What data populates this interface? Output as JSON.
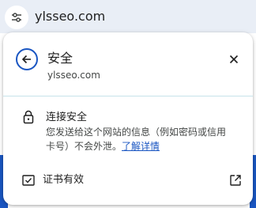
{
  "address_bar": {
    "url": "ylsseo.com",
    "site_info_icon": "tune-icon"
  },
  "popup": {
    "back_icon": "arrow-back-icon",
    "title": "安全",
    "subtitle": "ylsseo.com",
    "close_icon": "close-icon",
    "connection": {
      "icon": "lock-icon",
      "title": "连接安全",
      "description": "您发送给这个网站的信息（例如密码或信用卡号）不会外泄。",
      "learn_more": "了解详情"
    },
    "certificate": {
      "icon": "certificate-icon",
      "label": "证书有效",
      "external_icon": "open-in-new-icon"
    }
  },
  "colors": {
    "accent": "#1a56c2",
    "addressbar_bg": "#e9eef6",
    "divider": "#c7e3ea"
  }
}
